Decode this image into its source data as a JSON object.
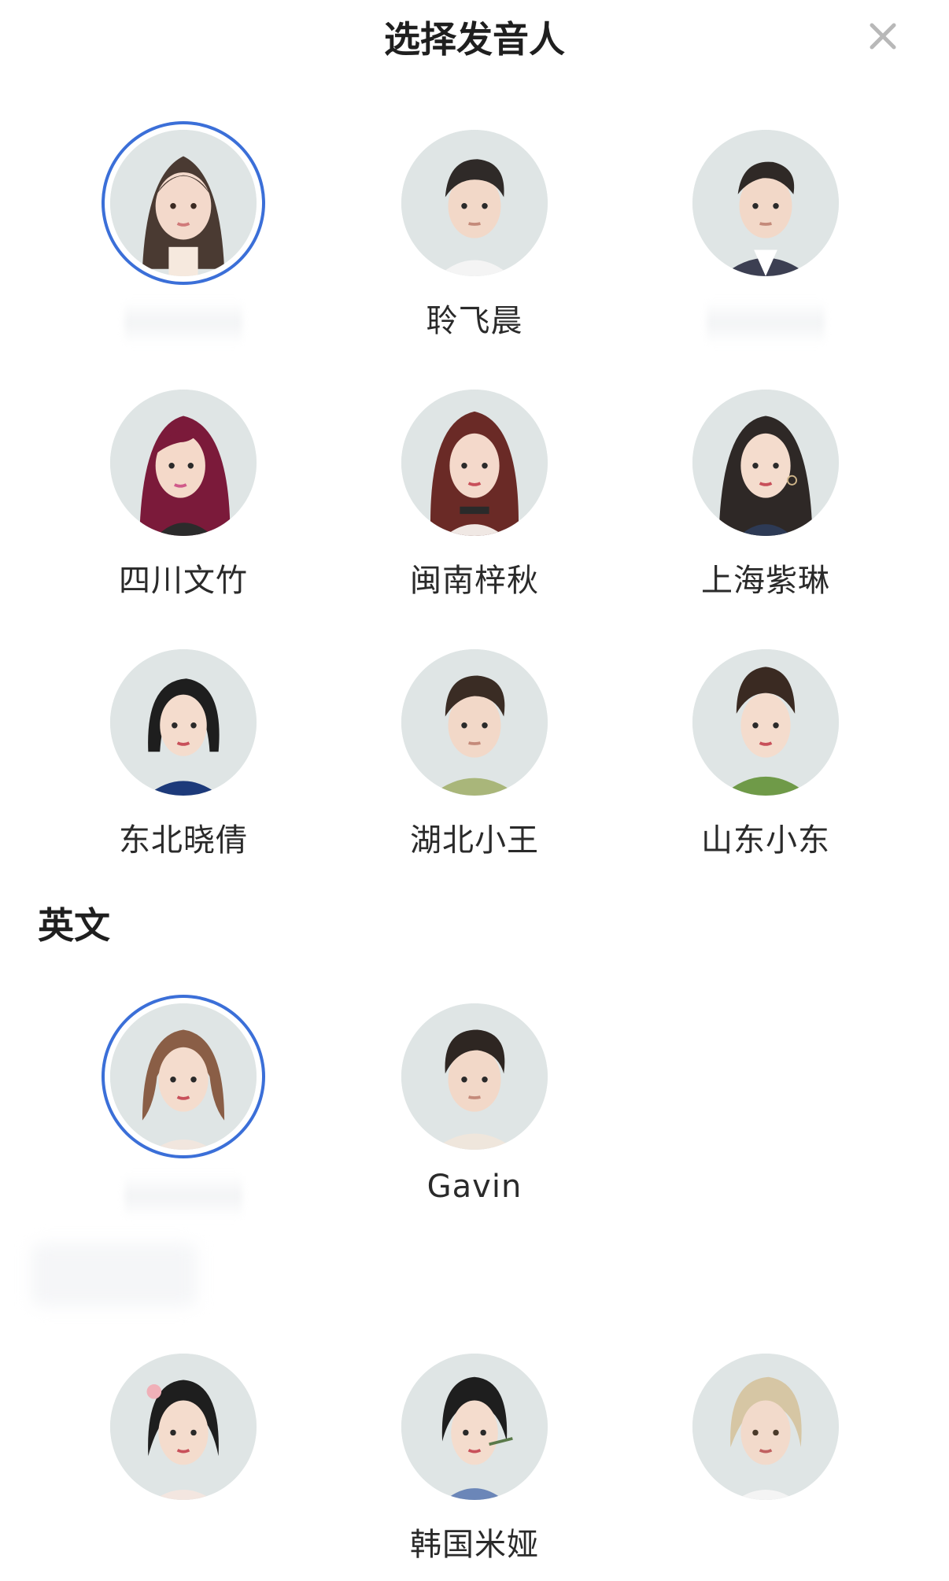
{
  "header": {
    "title": "选择发音人"
  },
  "sections": {
    "english": {
      "title": "英文"
    }
  },
  "voices_cn": [
    {
      "name": "",
      "selected": true
    },
    {
      "name": "聆飞晨",
      "selected": false
    },
    {
      "name": "",
      "selected": false
    },
    {
      "name": "四川文竹",
      "selected": false
    },
    {
      "name": "闽南梓秋",
      "selected": false
    },
    {
      "name": "上海紫琳",
      "selected": false
    },
    {
      "name": "东北晓倩",
      "selected": false
    },
    {
      "name": "湖北小王",
      "selected": false
    },
    {
      "name": "山东小东",
      "selected": false
    }
  ],
  "voices_en": [
    {
      "name": "",
      "selected": true
    },
    {
      "name": "Gavin",
      "selected": false
    }
  ],
  "voices_other": [
    {
      "name": ""
    },
    {
      "name": "韩国米娅"
    },
    {
      "name": ""
    }
  ],
  "colors": {
    "accent": "#3b6fd8",
    "avatar_bg": "#dfe5e5"
  }
}
